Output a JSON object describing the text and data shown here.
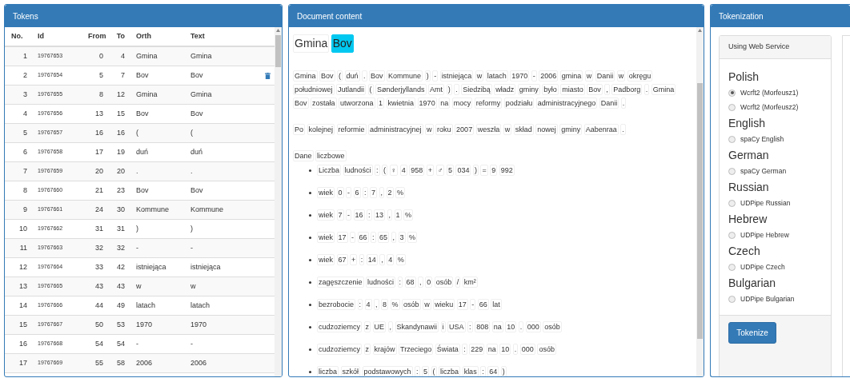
{
  "tokens_panel": {
    "title": "Tokens",
    "columns": [
      "No.",
      "Id",
      "From",
      "To",
      "Orth",
      "Text"
    ],
    "rows": [
      {
        "no": "1",
        "id": "19767653",
        "from": "0",
        "to": "4",
        "orth": "Gmina",
        "text": "Gmina",
        "delete_icon": false
      },
      {
        "no": "2",
        "id": "19767654",
        "from": "5",
        "to": "7",
        "orth": "Bov",
        "text": "Bov",
        "delete_icon": true
      },
      {
        "no": "3",
        "id": "19767655",
        "from": "8",
        "to": "12",
        "orth": "Gmina",
        "text": "Gmina",
        "delete_icon": false
      },
      {
        "no": "4",
        "id": "19767656",
        "from": "13",
        "to": "15",
        "orth": "Bov",
        "text": "Bov",
        "delete_icon": false
      },
      {
        "no": "5",
        "id": "19767657",
        "from": "16",
        "to": "16",
        "orth": "(",
        "text": "(",
        "delete_icon": false
      },
      {
        "no": "6",
        "id": "19767658",
        "from": "17",
        "to": "19",
        "orth": "duń",
        "text": "duń",
        "delete_icon": false
      },
      {
        "no": "7",
        "id": "19767659",
        "from": "20",
        "to": "20",
        "orth": ".",
        "text": ".",
        "delete_icon": false
      },
      {
        "no": "8",
        "id": "19767660",
        "from": "21",
        "to": "23",
        "orth": "Bov",
        "text": "Bov",
        "delete_icon": false
      },
      {
        "no": "9",
        "id": "19767661",
        "from": "24",
        "to": "30",
        "orth": "Kommune",
        "text": "Kommune",
        "delete_icon": false
      },
      {
        "no": "10",
        "id": "19767662",
        "from": "31",
        "to": "31",
        "orth": ")",
        "text": ")",
        "delete_icon": false
      },
      {
        "no": "11",
        "id": "19767663",
        "from": "32",
        "to": "32",
        "orth": "-",
        "text": "-",
        "delete_icon": false
      },
      {
        "no": "12",
        "id": "19767664",
        "from": "33",
        "to": "42",
        "orth": "istniejąca",
        "text": "istniejąca",
        "delete_icon": false
      },
      {
        "no": "13",
        "id": "19767665",
        "from": "43",
        "to": "43",
        "orth": "w",
        "text": "w",
        "delete_icon": false
      },
      {
        "no": "14",
        "id": "19767666",
        "from": "44",
        "to": "49",
        "orth": "latach",
        "text": "latach",
        "delete_icon": false
      },
      {
        "no": "15",
        "id": "19767667",
        "from": "50",
        "to": "53",
        "orth": "1970",
        "text": "1970",
        "delete_icon": false
      },
      {
        "no": "16",
        "id": "19767668",
        "from": "54",
        "to": "54",
        "orth": "-",
        "text": "-",
        "delete_icon": false
      },
      {
        "no": "17",
        "id": "19767669",
        "from": "55",
        "to": "58",
        "orth": "2006",
        "text": "2006",
        "delete_icon": false
      }
    ]
  },
  "document_panel": {
    "title": "Document content",
    "heading": [
      {
        "text": "Gmina",
        "selected": false
      },
      {
        "text": "Bov",
        "selected": true
      }
    ],
    "paragraphs": [
      [
        "Gmina",
        "Bov",
        "(",
        "duń",
        ".",
        "Bov",
        "Kommune",
        ")",
        "-",
        "istniejąca",
        "w",
        "latach",
        "1970",
        "-",
        "2006",
        "gmina",
        "w",
        "Danii",
        "w",
        "okręgu",
        "południowej",
        "Jutlandii",
        "(",
        "Sønderjyllands",
        "Amt",
        ")",
        ".",
        "Siedzibą",
        "władz",
        "gminy",
        "było",
        "miasto",
        "Bov",
        ",",
        "Padborg",
        ".",
        "Gmina",
        "Bov",
        "została",
        "utworzona",
        "1",
        "kwietnia",
        "1970",
        "na",
        "mocy",
        "reformy",
        "podziału",
        "administracyjnego",
        "Danii",
        "."
      ],
      [
        "Po",
        "kolejnej",
        "reformie",
        "administracyjnej",
        "w",
        "roku",
        "2007",
        "weszła",
        "w",
        "skład",
        "nowej",
        "gminy",
        "Aabenraa",
        "."
      ],
      [
        "Dane",
        "liczbowe"
      ]
    ],
    "list_items": [
      [
        "Liczba",
        "ludności",
        ":",
        "(",
        "♀",
        "4",
        "958",
        "+",
        "♂",
        "5",
        "034",
        ")",
        "=",
        "9",
        "992"
      ],
      [
        "wiek",
        "0",
        "-",
        "6",
        ":",
        "7",
        ",",
        "2",
        "%"
      ],
      [
        "wiek",
        "7",
        "-",
        "16",
        ":",
        "13",
        ",",
        "1",
        "%"
      ],
      [
        "wiek",
        "17",
        "-",
        "66",
        ":",
        "65",
        ",",
        "3",
        "%"
      ],
      [
        "wiek",
        "67",
        "+",
        ":",
        "14",
        ",",
        "4",
        "%"
      ],
      [
        "zagęszczenie",
        "ludności",
        ":",
        "68",
        ",",
        "0",
        "osób",
        "/",
        "km²"
      ],
      [
        "bezrobocie",
        ":",
        "4",
        ",",
        "8",
        "%",
        "osób",
        "w",
        "wieku",
        "17",
        "-",
        "66",
        "lat"
      ],
      [
        "cudzoziemcy",
        "z",
        "UE",
        ",",
        "Skandynawii",
        "i",
        "USA",
        ":",
        "808",
        "na",
        "10",
        ".",
        "000",
        "osób"
      ],
      [
        "cudzoziemcy",
        "z",
        "krajów",
        "Trzeciego",
        "Świata",
        ":",
        "229",
        "na",
        "10",
        ".",
        "000",
        "osób"
      ],
      [
        "liczba",
        "szkół",
        "podstawowych",
        ":",
        "5",
        "(",
        "liczba",
        "klas",
        ":",
        "64",
        ")"
      ]
    ]
  },
  "tokenization_panel": {
    "title": "Tokenization",
    "subtitle": "Using Web Service",
    "languages": [
      {
        "name": "Polish",
        "options": [
          {
            "label": "Wcrft2 (Morfeusz1)",
            "selected": true
          },
          {
            "label": "Wcrft2 (Morfeusz2)",
            "selected": false
          }
        ]
      },
      {
        "name": "English",
        "options": [
          {
            "label": "spaCy English",
            "selected": false
          }
        ]
      },
      {
        "name": "German",
        "options": [
          {
            "label": "spaCy German",
            "selected": false
          }
        ]
      },
      {
        "name": "Russian",
        "options": [
          {
            "label": "UDPipe Russian",
            "selected": false
          }
        ]
      },
      {
        "name": "Hebrew",
        "options": [
          {
            "label": "UDPipe Hebrew",
            "selected": false
          }
        ]
      },
      {
        "name": "Czech",
        "options": [
          {
            "label": "UDPipe Czech",
            "selected": false
          }
        ]
      },
      {
        "name": "Bulgarian",
        "options": [
          {
            "label": "UDPipe Bulgarian",
            "selected": false
          }
        ]
      }
    ],
    "button": "Tokenize"
  }
}
